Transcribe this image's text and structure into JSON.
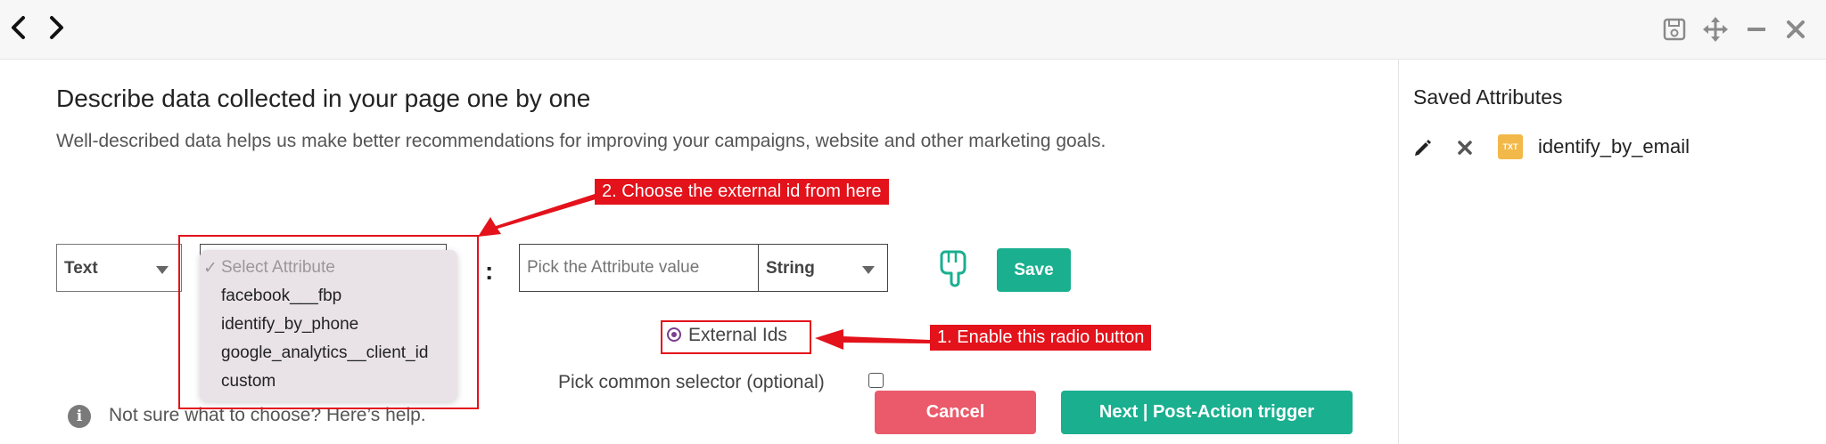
{
  "toolbar": {
    "icons": [
      "back-icon",
      "forward-icon",
      "save-icon",
      "move-icon",
      "minimize-icon",
      "close-icon"
    ]
  },
  "main": {
    "title": "Describe data collected in your page one by one",
    "subtitle": "Well-described data helps us make better recommendations for improving your campaigns, website and other marketing goals."
  },
  "form": {
    "type_select": "Text",
    "attribute_dropdown": {
      "selected_label": "Select Attribute",
      "options": [
        "facebook___fbp",
        "identify_by_phone",
        "google_analytics__client_id",
        "custom"
      ]
    },
    "separator": ":",
    "attribute_value_placeholder": "Pick the Attribute value",
    "value_type": "String",
    "save_label": "Save",
    "external_ids_label": "External Ids",
    "common_selector_label": "Pick common selector (optional)",
    "help_text": "Not sure what to choose? Here’s help.",
    "cancel_label": "Cancel",
    "next_label": "Next | Post-Action trigger"
  },
  "annotations": {
    "step1": "1. Enable this radio button",
    "step2": "2. Choose the external id from here",
    "color": "#e3121b"
  },
  "saved_attributes": {
    "title": "Saved Attributes",
    "items": [
      {
        "badge": "TXT",
        "name": "identify_by_email"
      }
    ]
  },
  "colors": {
    "primary": "#1aaf8f",
    "danger": "#ea5a6a",
    "badge": "#f3b84a",
    "radio": "#7a3d8f"
  }
}
